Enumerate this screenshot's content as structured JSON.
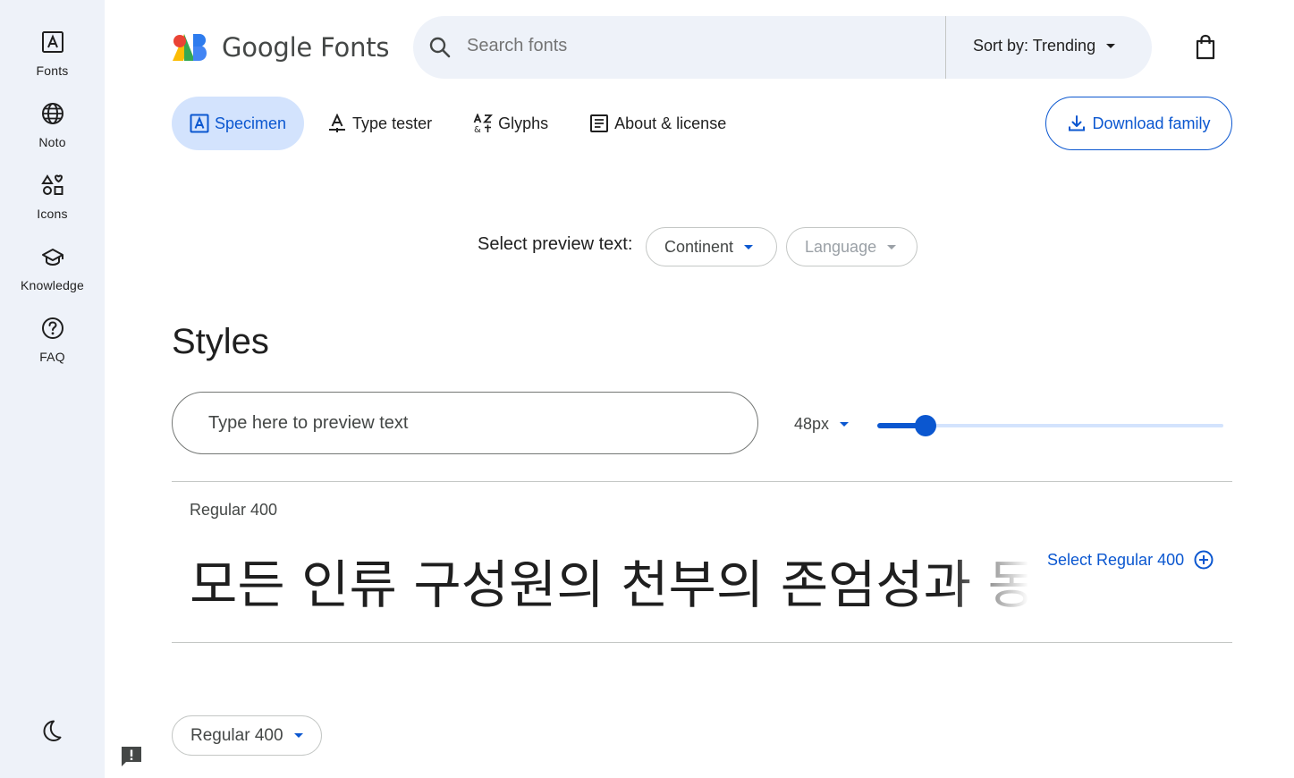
{
  "rail": {
    "items": [
      {
        "label": "Fonts",
        "icon": "font-icon"
      },
      {
        "label": "Noto",
        "icon": "globe-icon"
      },
      {
        "label": "Icons",
        "icon": "shapes-icon"
      },
      {
        "label": "Knowledge",
        "icon": "graduation-cap-icon"
      },
      {
        "label": "FAQ",
        "icon": "help-circle-icon"
      }
    ],
    "theme_toggle_icon": "dark-mode-icon"
  },
  "header": {
    "logo_text": "Google Fonts",
    "search_placeholder": "Search fonts",
    "sort_label": "Sort by: Trending"
  },
  "tabs": [
    {
      "label": "Specimen",
      "icon": "specimen-icon",
      "active": true
    },
    {
      "label": "Type tester",
      "icon": "type-tester-icon",
      "active": false
    },
    {
      "label": "Glyphs",
      "icon": "glyphs-icon",
      "active": false
    },
    {
      "label": "About & license",
      "icon": "article-icon",
      "active": false
    }
  ],
  "download_label": "Download family",
  "preview_text": {
    "label": "Select preview text:",
    "continent": "Continent",
    "language": "Language"
  },
  "styles": {
    "heading": "Styles",
    "input_placeholder": "Type here to preview text",
    "size_label": "48px",
    "size_slider_fraction": 0.14,
    "items": [
      {
        "name": "Regular 400",
        "sample": "모든 인류 구성원의 천부의 존엄성과 동등하고 양도할 수 없는 권리를",
        "select_label": "Select Regular 400"
      }
    ]
  },
  "weight_selector": "Regular 400",
  "colors": {
    "accent": "#0b57d0",
    "rail_bg": "#eef2f9",
    "active_tab_bg": "#d3e3fd"
  }
}
